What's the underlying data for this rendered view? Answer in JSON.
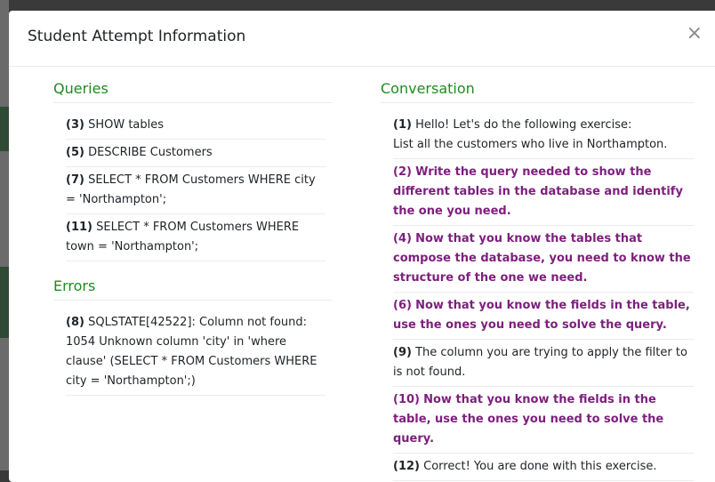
{
  "modal": {
    "title": "Student Attempt Information",
    "close_label": "×"
  },
  "queries": {
    "title": "Queries",
    "items": [
      {
        "num": "(3)",
        "text": "SHOW tables"
      },
      {
        "num": "(5)",
        "text": "DESCRIBE Customers"
      },
      {
        "num": "(7)",
        "text": "SELECT * FROM Customers WHERE city = 'Northampton';"
      },
      {
        "num": "(11)",
        "text": "SELECT * FROM Customers WHERE town = 'Northampton';"
      }
    ]
  },
  "errors": {
    "title": "Errors",
    "items": [
      {
        "num": "(8)",
        "text": "SQLSTATE[42522]: Column not found: 1054 Unknown column 'city' in 'where clause' (SELECT * FROM Customers WHERE city = 'Northampton';)"
      }
    ]
  },
  "conversation": {
    "title": "Conversation",
    "items": [
      {
        "num": "(1)",
        "text": "Hello! Let's do the following exercise:",
        "text2": "List all the customers who live in Northampton.",
        "role": "system"
      },
      {
        "num": "(2)",
        "text": "Write the query needed to show the different tables in the database and identify the one you need.",
        "role": "bot"
      },
      {
        "num": "(4)",
        "text": "Now that you know the tables that compose the database, you need to know the structure of the one we need.",
        "role": "bot"
      },
      {
        "num": "(6)",
        "text": "Now that you know the fields in the table, use the ones you need to solve the query.",
        "role": "bot"
      },
      {
        "num": "(9)",
        "text": "The column you are trying to apply the filter to is not found.",
        "role": "system"
      },
      {
        "num": "(10)",
        "text": "Now that you know the fields in the table, use the ones you need to solve the query.",
        "role": "bot"
      },
      {
        "num": "(12)",
        "text": "Correct! You are done with this exercise.",
        "role": "system"
      }
    ]
  },
  "colors": {
    "section_title": "#1f8c1f",
    "bot_message": "#7d1f7d"
  }
}
